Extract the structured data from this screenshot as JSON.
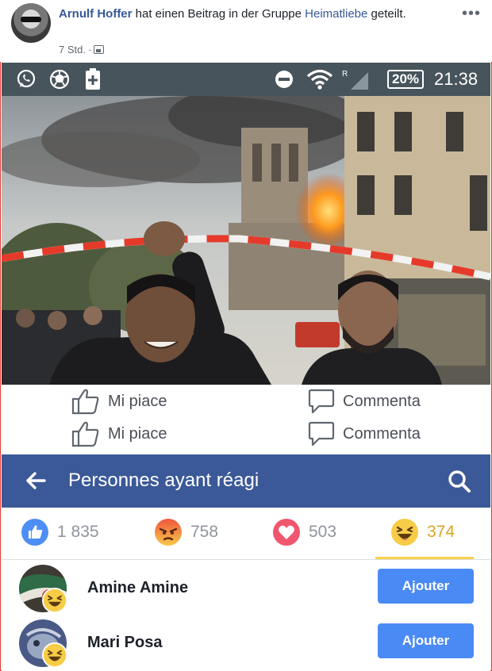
{
  "post": {
    "author": "Arnulf Hoffer",
    "action_text": " hat einen Beitrag in der Gruppe ",
    "group": "Heimatliebe",
    "action_suffix": " geteilt.",
    "time": "7 Std.",
    "more_icon": "more-dots-icon",
    "audience_icon": "group-audience-icon"
  },
  "status_bar": {
    "left_icons": [
      "whatsapp-icon",
      "ball-icon",
      "battery-saver-icon"
    ],
    "right_icons": [
      "do-not-disturb-icon",
      "wifi-icon",
      "roaming-signal-icon"
    ],
    "roaming_mark": "R",
    "battery": "20%",
    "time": "21:38"
  },
  "actions": [
    {
      "like": "Mi piace",
      "comment": "Commenta"
    },
    {
      "like": "Mi piace",
      "comment": "Commenta"
    }
  ],
  "reactions": {
    "title": "Personnes ayant réagi",
    "back_icon": "back-arrow-icon",
    "search_icon": "search-icon",
    "tabs": [
      {
        "icon": "like-reaction-icon",
        "count": "1 835"
      },
      {
        "icon": "angry-reaction-icon",
        "count": "758"
      },
      {
        "icon": "love-reaction-icon",
        "count": "503"
      },
      {
        "icon": "haha-reaction-icon",
        "count": "374"
      }
    ],
    "people": [
      {
        "name": "Amine Amine",
        "button": "Ajouter",
        "reaction": "haha-reaction-icon"
      },
      {
        "name": "Mari Posa",
        "button": "Ajouter",
        "reaction": "haha-reaction-icon"
      }
    ]
  },
  "colors": {
    "facebook_blue": "#3b5998",
    "link_blue": "#365899",
    "status_bar": "#47545b",
    "add_button": "#4a8af4",
    "active_tab": "#f7d14b"
  }
}
